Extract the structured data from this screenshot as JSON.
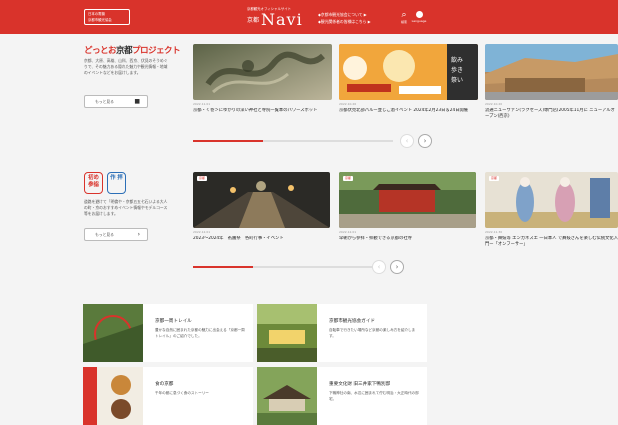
{
  "header": {
    "badge_line1": "日本の電機",
    "badge_line2": "京都市観光協会",
    "logo_sub": "京都観光オフィシャルサイト",
    "logo_kanji": "京都",
    "logo_main": "Navi",
    "link1": "◆京都市観光協会について ▶",
    "link2": "◆観光関係者の皆様はこちら ▶",
    "search_label": "検索",
    "lang_label": "Language"
  },
  "section1": {
    "title_red": "どっとお",
    "title_dark": "京都",
    "title_end": "プロジェクト",
    "desc": "京都、大原、高雄、山科、西京、伏見のそうめぐりで、その魅力ある隠れた魅力や観光情報・地域のイベントなどをお届けします。",
    "more_label": "もっと見る",
    "cards": [
      {
        "date": "2022.11.01",
        "title": "京都・く巻＞にゆかりの深い神社と寺院一覧本のパワースポット"
      },
      {
        "date": "2022.10.26",
        "title": "京都伏見北部パルー並じご酒イベント 2024年2月23日＆24日開催"
      },
      {
        "date": "2022.10.20",
        "title": "流通ニューヴァン(ラクセーズ)専門店(2005年11月に ニューアルオープン(西京)"
      }
    ],
    "progress": 0.35
  },
  "section2": {
    "hanko1": "初め 参詣",
    "hanko2": "作 拝",
    "desc": "道路を避けて「明倫や・京都五五七石いよる大人の町・京のおすすめイベント情報やモデルコース等をお届けします。",
    "more_label": "もっと見る",
    "cards": [
      {
        "tag": "京都",
        "date": "2022.12.01",
        "title": "2023〜2024年　祇園祭　各町行事・イベント"
      },
      {
        "tag": "京都",
        "date": "2022.12.01",
        "title": "早朝から参拝・拝観できる京都の社寺"
      },
      {
        "tag": "京都",
        "date": "2022.11.30",
        "title": "京都・舞妓等 エンカネスエ 一日本人 で舞妓さんを楽しむ伝統文化入門ー「オンフーサー」"
      }
    ],
    "progress": 0.32
  },
  "guides": [
    {
      "title": "京都一周トレイル",
      "desc": "豊かな自然に囲まれた京都の魅力に出会える「京都一周トレイル」のご紹介でした。"
    },
    {
      "title": "京都市観光協会ガイド",
      "desc": "自転車で行きたい場所など京都の楽しみ方を紹介します。"
    },
    {
      "title": "食の京都",
      "desc": "千年の都に息づく食のストーリー"
    },
    {
      "title": "重要文化財 旧三井家下鴨別邸",
      "desc": "下鴨神社の南、水辺に囲まれて佇む明治・大正時代の邸宅。"
    }
  ],
  "colors": {
    "accent": "#d9332b"
  }
}
